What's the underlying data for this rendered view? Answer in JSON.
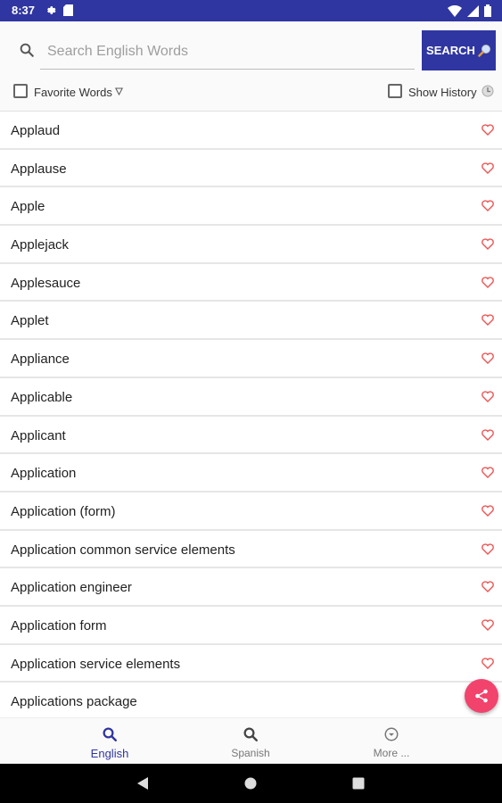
{
  "statusbar": {
    "time": "8:37",
    "icons": [
      "gear-icon",
      "sd-card-icon",
      "wifi-icon",
      "signal-icon",
      "battery-icon"
    ]
  },
  "search": {
    "placeholder": "Search English Words",
    "value": "",
    "button_label": "SEARCH"
  },
  "filters": {
    "favorite_label": "Favorite Words",
    "favorite_checked": false,
    "history_label": "Show History",
    "history_checked": false
  },
  "words": [
    "Applaud",
    "Applause",
    "Apple",
    "Applejack",
    "Applesauce",
    "Applet",
    "Appliance",
    "Applicable",
    "Applicant",
    "Application",
    "Application (form)",
    "Application common service elements",
    "Application engineer",
    "Application form",
    "Application service elements",
    "Applications package"
  ],
  "nav": {
    "tabs": [
      {
        "label": "English"
      },
      {
        "label": "Spanish"
      },
      {
        "label": "More ..."
      }
    ],
    "active": "English"
  },
  "colors": {
    "primary": "#2f36a1",
    "heart": "#ee5555",
    "fab": "#f2436c"
  }
}
